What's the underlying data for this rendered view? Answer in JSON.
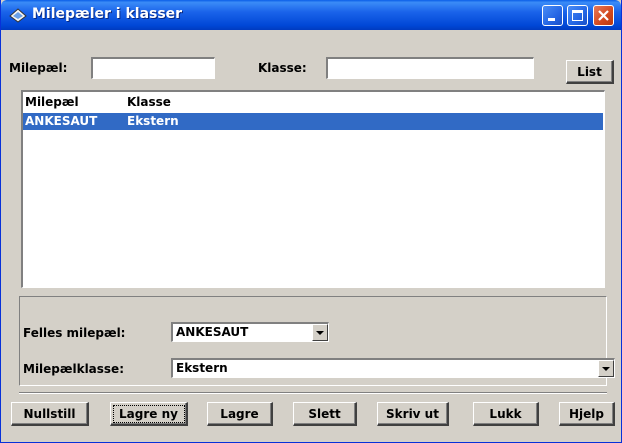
{
  "window": {
    "title": "Milepæler i klasser",
    "minimize": "minimize",
    "maximize": "maximize",
    "close": "close"
  },
  "filter": {
    "milepael_label": "Milepæl:",
    "milepael_value": "",
    "klasse_label": "Klasse:",
    "klasse_value": "",
    "list_button": "List"
  },
  "table": {
    "columns": [
      "Milepæl",
      "Klasse"
    ],
    "rows": [
      {
        "milepael": "ANKESAUT",
        "klasse": "Ekstern",
        "selected": true
      }
    ]
  },
  "form": {
    "felles_label": "Felles milepæl:",
    "felles_value": "ANKESAUT",
    "klasse_label": "Milepælklasse:",
    "klasse_value": "Ekstern"
  },
  "buttons": {
    "nullstill": "Nullstill",
    "lagre_ny": "Lagre ny",
    "lagre": "Lagre",
    "slett": "Slett",
    "skriv_ut": "Skriv ut",
    "lukk": "Lukk",
    "hjelp": "Hjelp"
  },
  "colors": {
    "title_bar": "#0a5ee8",
    "selection": "#316ac5",
    "face": "#d4d0c8"
  }
}
